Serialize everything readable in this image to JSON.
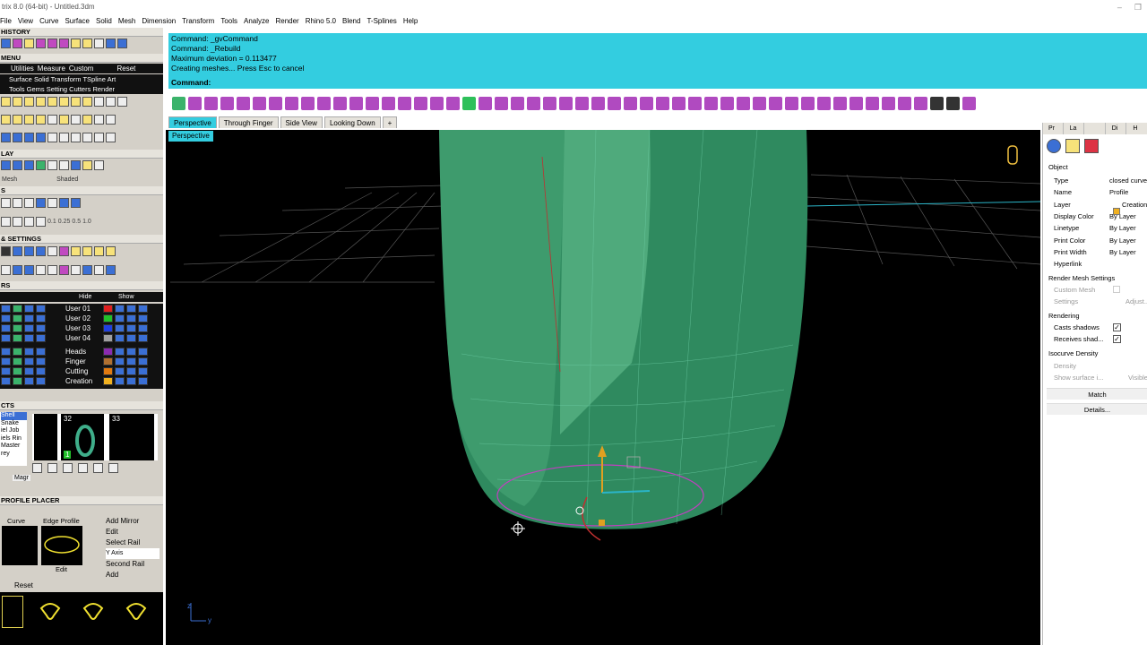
{
  "window": {
    "title": "trix 8.0 (64-bit) - Untitled.3dm"
  },
  "menu": [
    "File",
    "View",
    "Curve",
    "Surface",
    "Solid",
    "Mesh",
    "Dimension",
    "Transform",
    "Tools",
    "Analyze",
    "Render",
    "Rhino 5.0",
    "Blend",
    "T-Splines",
    "Help"
  ],
  "command": {
    "history": [
      "Command: _gvCommand",
      "Command: _Rebuild",
      "Maximum deviation = 0.113477",
      "Creating meshes... Press Esc to cancel"
    ],
    "prompt": "Command:",
    "value": ""
  },
  "left": {
    "sections": [
      "HISTORY",
      "MENU",
      "LAY",
      "S",
      "& SETTINGS",
      "RS",
      "CTS",
      "PROFILE PLACER"
    ],
    "menu_tabs": [
      "Utilities",
      "Measure",
      "Custom"
    ],
    "menu_reset": "Reset",
    "menu_items": [
      "Surface",
      "Solid",
      "Transform",
      "TSpline",
      "Art",
      "Tools",
      "Gems",
      "Setting",
      "Cutters",
      "Render"
    ],
    "display_labels": [
      "Mesh",
      "Shaded"
    ],
    "snap_values": [
      "0.1",
      "0.25",
      "0.5",
      "1.0"
    ],
    "layer_header": [
      "Hide",
      "Show"
    ],
    "layers": [
      {
        "name": "User 01",
        "color": "#e02020"
      },
      {
        "name": "User 02",
        "color": "#22c02a"
      },
      {
        "name": "User 03",
        "color": "#2040e0"
      },
      {
        "name": "User 04",
        "color": "#a0a0a0"
      },
      {
        "name": "Heads",
        "color": "#8a2bb0"
      },
      {
        "name": "Finger",
        "color": "#b07030"
      },
      {
        "name": "Cutting",
        "color": "#e07a10"
      },
      {
        "name": "Creation",
        "color": "#f0b020"
      }
    ],
    "objects": [
      "Shell",
      "Snake",
      "iel Job",
      "iels Rin",
      "Master",
      "rey"
    ],
    "thumbs": [
      "32",
      "33"
    ],
    "thumb_badge": "1",
    "magr": "Magr",
    "profile": {
      "curve_label": "Curve",
      "edge_label": "Edge Profile",
      "edit_label": "Edit",
      "reset": "Reset",
      "options": [
        "Add Mirror",
        "Edit",
        "Select Rail",
        "Y Axis",
        "Second Rail",
        "Add"
      ]
    }
  },
  "viewport": {
    "tabs": [
      "Perspective",
      "Through Finger",
      "Side View",
      "Looking Down"
    ],
    "add_tab": "+",
    "label": "Perspective",
    "axis_labels": [
      "z",
      "y"
    ]
  },
  "properties": {
    "tabs": [
      "Pr",
      "La",
      "",
      "Di",
      "H"
    ],
    "object_section": "Object",
    "rows": [
      {
        "k": "Type",
        "v": "closed curve"
      },
      {
        "k": "Name",
        "v": "Profile"
      },
      {
        "k": "Layer",
        "v": "Creation"
      },
      {
        "k": "Display Color",
        "v": "By Layer"
      },
      {
        "k": "Linetype",
        "v": "By Layer"
      },
      {
        "k": "Print Color",
        "v": "By Layer"
      },
      {
        "k": "Print Width",
        "v": "By Layer"
      },
      {
        "k": "Hyperlink",
        "v": ""
      }
    ],
    "render_section": "Render Mesh Settings",
    "custom_mesh": "Custom Mesh",
    "settings": "Settings",
    "adjust": "Adjust...",
    "rendering_section": "Rendering",
    "casts_shadows": "Casts shadows",
    "receives_shadows": "Receives shad...",
    "isocurve_section": "Isocurve Density",
    "density": "Density",
    "show_surface": "Show surface i...",
    "visible": "Visible",
    "match": "Match",
    "details": "Details..."
  }
}
